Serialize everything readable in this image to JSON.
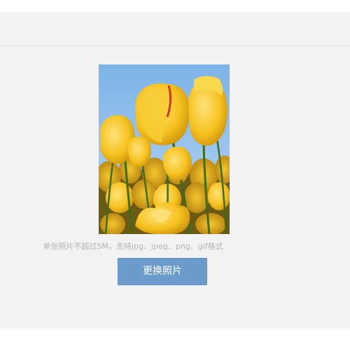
{
  "upload": {
    "photo_alt": "黄色郁金香",
    "hint": "单张照片不超过5M，支持jpg、jpeg、png、gif格式",
    "change_button_label": "更换照片"
  },
  "colors": {
    "panel_bg": "#f2f2f2",
    "button_bg": "#6a9bcb",
    "hint_text": "#b3b3b3"
  }
}
